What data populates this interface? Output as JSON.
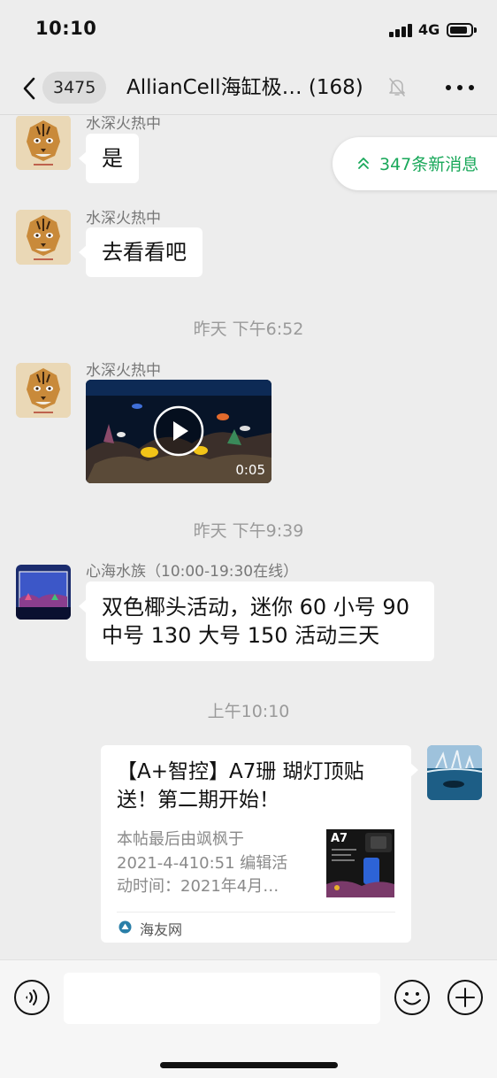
{
  "status_bar": {
    "time": "10:10",
    "network": "4G"
  },
  "header": {
    "unread_count": "3475",
    "title": "AllianCell海缸极…",
    "member_count": "(168)"
  },
  "new_messages": {
    "label": "347条新消息"
  },
  "messages": [
    {
      "sender": "水深火热中",
      "text": "是"
    },
    {
      "sender": "水深火热中",
      "text": "去看看吧"
    },
    {
      "timestamp": "昨天 下午6:52"
    },
    {
      "sender": "水深火热中",
      "video_duration": "0:05"
    },
    {
      "timestamp": "昨天 下午9:39"
    },
    {
      "sender": "心海水族（10:00-19:30在线）",
      "text_line1": "双色椰头活动，迷你 60 小号 90",
      "text_line2": "中号 130 大号 150 活动三天"
    },
    {
      "timestamp": "上午10:10"
    }
  ],
  "link_card": {
    "title": "【A+智控】A7珊 瑚灯顶贴送！第二期开始！",
    "desc_line1": "本帖最后由飒枫于",
    "desc_line2": "2021-4-410:51 编辑活",
    "desc_line3": "动时间：2021年4月…",
    "thumb_label": "A7",
    "source": "海友网"
  },
  "colors": {
    "accent_green": "#19a85a",
    "background": "#ededed",
    "bubble": "#ffffff"
  }
}
